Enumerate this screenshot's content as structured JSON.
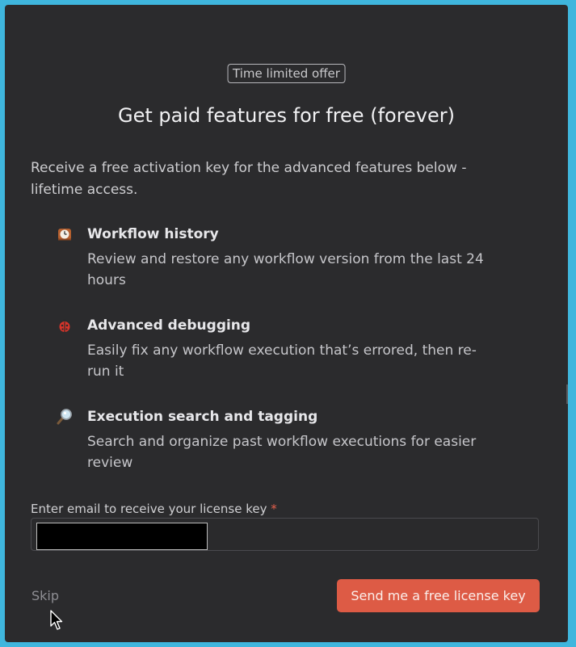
{
  "dialog": {
    "badge": "Time limited offer",
    "title": "Get paid features for free (forever)",
    "intro": "Receive a free activation key for the advanced features below - lifetime access."
  },
  "features": [
    {
      "icon": "mantel-clock-icon",
      "title": "Workflow history",
      "description": "Review and restore any workflow version from the last 24 hours"
    },
    {
      "icon": "ladybug-icon",
      "title": "Advanced debugging",
      "description": "Easily fix any workflow execution that’s errored, then re-run it"
    },
    {
      "icon": "magnifying-glass-icon",
      "title": "Execution search and tagging",
      "description": "Search and organize past workflow executions for easier review"
    }
  ],
  "form": {
    "email_label": "Enter email to receive your license key",
    "required_marker": "*",
    "email_value": "",
    "email_redacted": true
  },
  "actions": {
    "skip_label": "Skip",
    "submit_label": "Send me a free license key"
  },
  "colors": {
    "background": "#2b2b2d",
    "accent": "#dd5b45",
    "outer_frame": "#3fb6dd",
    "required": "#e5604c"
  }
}
